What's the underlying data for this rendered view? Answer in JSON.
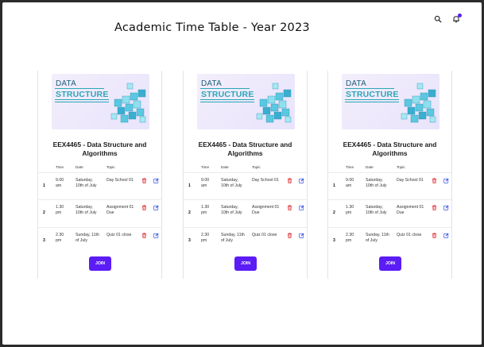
{
  "page": {
    "title": "Academic Time Table - Year 2023"
  },
  "top_icons": [
    "search-icon",
    "bell-icon"
  ],
  "colors": {
    "accent": "#5b1cf5",
    "delete": "#e0454a",
    "edit": "#3b55e6",
    "notification": "#5a1ff0"
  },
  "cards": [
    {
      "image": {
        "line1": "DATA",
        "line2": "STRUCTURE"
      },
      "title": "EEX4465 - Data Structure and Algorithms",
      "headers": {
        "time": "Time",
        "date": "Date",
        "topic": "Topic"
      },
      "rows": [
        {
          "num": "1",
          "time": "9.00 am",
          "date": "Saturday, 10th of July",
          "topic": "Day School 01"
        },
        {
          "num": "2",
          "time": "1.30 pm",
          "date": "Saturday, 10th of July",
          "topic": "Assignment 01 Due"
        },
        {
          "num": "3",
          "time": "2.30 pm",
          "date": "Sunday, 11th of July",
          "topic": "Quiz 01 close"
        }
      ],
      "join_label": "JOIN"
    },
    {
      "image": {
        "line1": "DATA",
        "line2": "STRUCTURE"
      },
      "title": "EEX4465 - Data Structure and Algorithms",
      "headers": {
        "time": "Time",
        "date": "Date",
        "topic": "Topic"
      },
      "rows": [
        {
          "num": "1",
          "time": "9.00 am",
          "date": "Saturday, 10th of July",
          "topic": "Day School 01"
        },
        {
          "num": "2",
          "time": "1.30 pm",
          "date": "Saturday, 10th of July",
          "topic": "Assignment 01 Due"
        },
        {
          "num": "3",
          "time": "2.30 pm",
          "date": "Sunday, 11th of July",
          "topic": "Quiz 01 close"
        }
      ],
      "join_label": "JOIN"
    },
    {
      "image": {
        "line1": "DATA",
        "line2": "STRUCTURE"
      },
      "title": "EEX4465 - Data Structure and Algorithms",
      "headers": {
        "time": "Time",
        "date": "Date",
        "topic": "Topic"
      },
      "rows": [
        {
          "num": "1",
          "time": "9.00 am",
          "date": "Saturday, 10th of July",
          "topic": "Day School 01"
        },
        {
          "num": "2",
          "time": "1.30 pm",
          "date": "Saturday, 10th of July",
          "topic": "Assignment 01 Due"
        },
        {
          "num": "3",
          "time": "2.30 pm",
          "date": "Sunday, 11th of July",
          "topic": "Quiz 01 close"
        }
      ],
      "join_label": "JOIN"
    }
  ]
}
